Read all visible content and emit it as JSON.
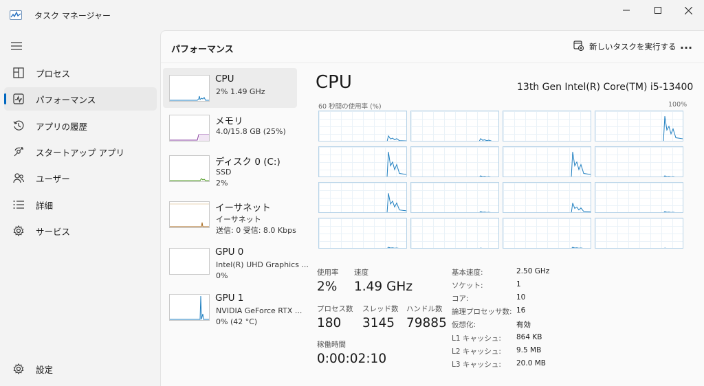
{
  "window": {
    "title": "タスク マネージャー"
  },
  "sidebar": {
    "items": [
      {
        "label": "プロセス",
        "icon": "processes-icon"
      },
      {
        "label": "パフォーマンス",
        "icon": "performance-icon",
        "active": true
      },
      {
        "label": "アプリの履歴",
        "icon": "app-history-icon"
      },
      {
        "label": "スタートアップ アプリ",
        "icon": "startup-apps-icon"
      },
      {
        "label": "ユーザー",
        "icon": "users-icon"
      },
      {
        "label": "詳細",
        "icon": "details-icon"
      },
      {
        "label": "サービス",
        "icon": "services-icon"
      }
    ],
    "settings_label": "設定"
  },
  "header": {
    "title": "パフォーマンス",
    "run_task_label": "新しいタスクを実行する"
  },
  "resources": [
    {
      "name": "CPU",
      "sub1": "2%  1.49 GHz",
      "sub2": "",
      "color": "#1f7fc0"
    },
    {
      "name": "メモリ",
      "sub1": "4.0/15.8 GB (25%)",
      "sub2": "",
      "color": "#8a3fa0"
    },
    {
      "name": "ディスク 0 (C:)",
      "sub1": "SSD",
      "sub2": "2%",
      "color": "#4e9a1f"
    },
    {
      "name": "イーサネット",
      "sub1": "イーサネット",
      "sub2": "送信: 0  受信: 8.0 Kbps",
      "color": "#a86a1d"
    },
    {
      "name": "GPU 0",
      "sub1": "Intel(R) UHD Graphics ...",
      "sub2": "0%",
      "color": "#1f7fc0"
    },
    {
      "name": "GPU 1",
      "sub1": "NVIDIA GeForce RTX ...",
      "sub2": "0% (42 °C)",
      "color": "#1f7fc0"
    }
  ],
  "detail": {
    "title": "CPU",
    "model": "13th Gen Intel(R) Core(TM) i5-13400",
    "graph_label": "60 秒間の使用率 (%)",
    "graph_max": "100%",
    "stats": {
      "usage_label": "使用率",
      "usage_value": "2%",
      "speed_label": "速度",
      "speed_value": "1.49 GHz",
      "processes_label": "プロセス数",
      "processes_value": "180",
      "threads_label": "スレッド数",
      "threads_value": "3145",
      "handles_label": "ハンドル数",
      "handles_value": "79885",
      "uptime_label": "稼働時間",
      "uptime_value": "0:00:02:10"
    },
    "specs": [
      {
        "k": "基本速度:",
        "v": "2.50 GHz"
      },
      {
        "k": "ソケット:",
        "v": "1"
      },
      {
        "k": "コア:",
        "v": "10"
      },
      {
        "k": "論理プロセッサ数:",
        "v": "16"
      },
      {
        "k": "仮想化:",
        "v": "有効"
      },
      {
        "k": "L1 キャッシュ:",
        "v": "864 KB"
      },
      {
        "k": "L2 キャッシュ:",
        "v": "9.5 MB"
      },
      {
        "k": "L3 キャッシュ:",
        "v": "20.0 MB"
      }
    ]
  },
  "colors": {
    "accent": "#0067c0",
    "cpu_line": "#1f7fc0"
  }
}
